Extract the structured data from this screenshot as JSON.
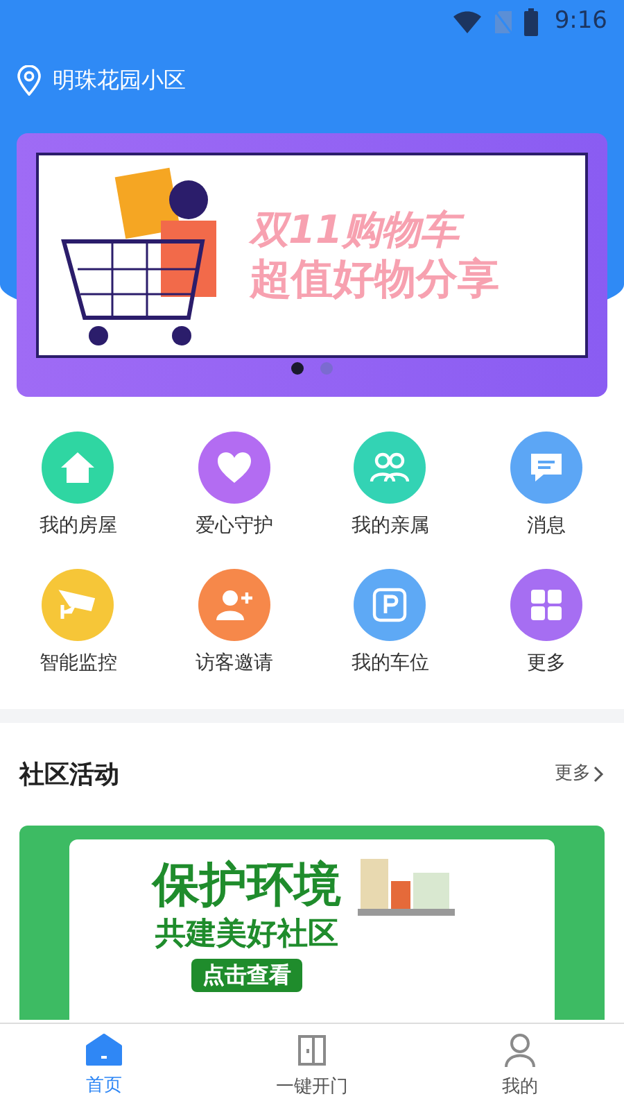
{
  "status_bar": {
    "time": "9:16"
  },
  "location": "明珠花园小区",
  "banner": {
    "line1": "双11购物车",
    "line2": "超值好物分享",
    "dots": [
      {
        "selected": true
      },
      {
        "selected": false
      }
    ]
  },
  "services": [
    {
      "label": "我的房屋",
      "color": "#2fd6a2"
    },
    {
      "label": "爱心守护",
      "color": "#b36cf2"
    },
    {
      "label": "我的亲属",
      "color": "#33d3b4"
    },
    {
      "label": "消息",
      "color": "#5ca6f5"
    },
    {
      "label": "智能监控",
      "color": "#f6c638"
    },
    {
      "label": "访客邀请",
      "color": "#f6884a"
    },
    {
      "label": "我的车位",
      "color": "#5ea9f5"
    },
    {
      "label": "更多",
      "color": "#a66ef2"
    }
  ],
  "section": {
    "title": "社区活动",
    "more": "更多"
  },
  "activity_banner": {
    "line1": "保护环境",
    "line2": "共建美好社区",
    "button": "点击查看"
  },
  "tabs": [
    {
      "label": "首页",
      "selected": true
    },
    {
      "label": "一键开门",
      "selected": false
    },
    {
      "label": "我的",
      "selected": false
    }
  ]
}
